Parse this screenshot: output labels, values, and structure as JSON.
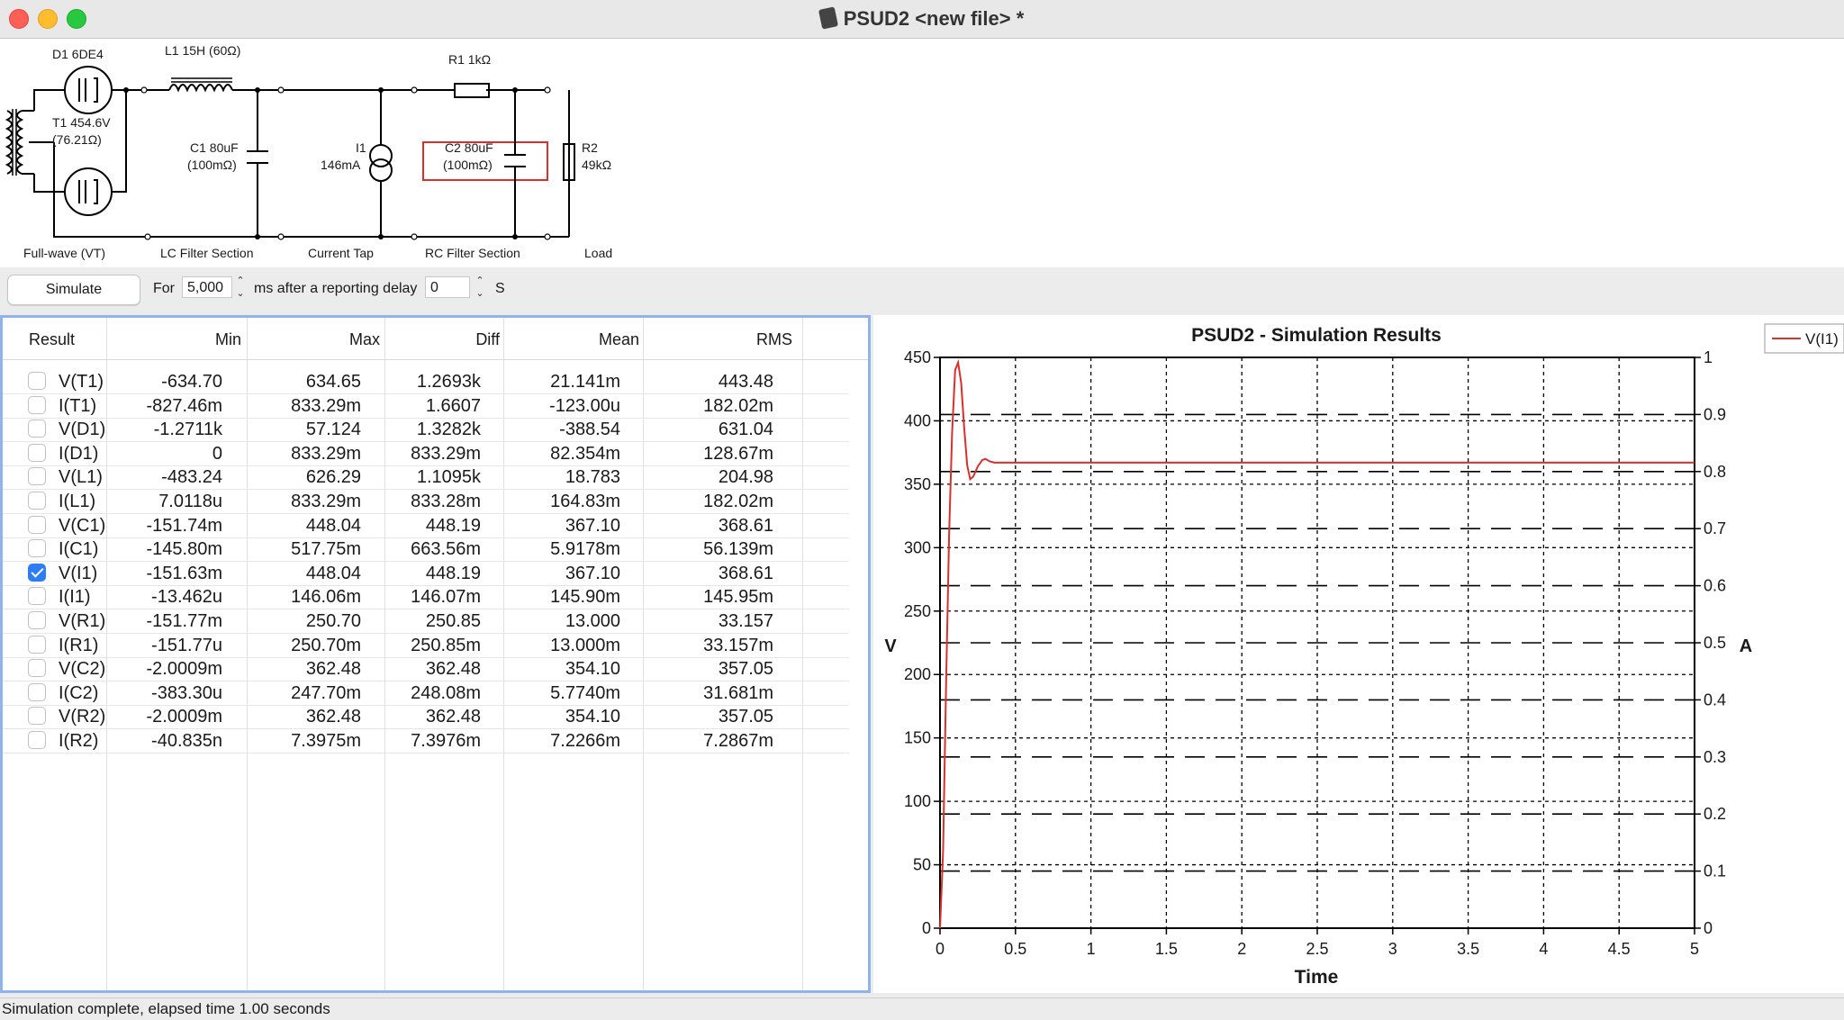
{
  "window": {
    "title": "PSUD2  <new file> *"
  },
  "schematic": {
    "components": {
      "d1": "D1 6DE4",
      "l1": "L1 15H (60Ω)",
      "r1": "R1 1kΩ",
      "t1_line1": "T1 454.6V",
      "t1_line2": "(76.21Ω)",
      "c1_line1": "C1 80uF",
      "c1_line2": "(100mΩ)",
      "i1_line1": "I1",
      "i1_line2": "146mA",
      "c2_line1": "C2 80uF",
      "c2_line2": "(100mΩ)",
      "r2_line1": "R2",
      "r2_line2": "49kΩ"
    },
    "sections": [
      "Full-wave (VT)",
      "LC Filter Section",
      "Current Tap",
      "RC Filter Section",
      "Load"
    ]
  },
  "controls": {
    "simulate_label": "Simulate",
    "for_label": "For",
    "duration_value": "5,000",
    "after_label": "ms after a reporting delay",
    "delay_value": "0",
    "delay_unit": "S"
  },
  "results": {
    "columns": [
      "Result",
      "Min",
      "Max",
      "Diff",
      "Mean",
      "RMS"
    ],
    "rows": [
      {
        "name": "V(T1)",
        "checked": false,
        "min": "-634.70",
        "max": "634.65",
        "diff": "1.2693k",
        "mean": "21.141m",
        "rms": "443.48"
      },
      {
        "name": "I(T1)",
        "checked": false,
        "min": "-827.46m",
        "max": "833.29m",
        "diff": "1.6607",
        "mean": "-123.00u",
        "rms": "182.02m"
      },
      {
        "name": "V(D1)",
        "checked": false,
        "min": "-1.2711k",
        "max": "57.124",
        "diff": "1.3282k",
        "mean": "-388.54",
        "rms": "631.04"
      },
      {
        "name": "I(D1)",
        "checked": false,
        "min": "0",
        "max": "833.29m",
        "diff": "833.29m",
        "mean": "82.354m",
        "rms": "128.67m"
      },
      {
        "name": "V(L1)",
        "checked": false,
        "min": "-483.24",
        "max": "626.29",
        "diff": "1.1095k",
        "mean": "18.783",
        "rms": "204.98"
      },
      {
        "name": "I(L1)",
        "checked": false,
        "min": "7.0118u",
        "max": "833.29m",
        "diff": "833.28m",
        "mean": "164.83m",
        "rms": "182.02m"
      },
      {
        "name": "V(C1)",
        "checked": false,
        "min": "-151.74m",
        "max": "448.04",
        "diff": "448.19",
        "mean": "367.10",
        "rms": "368.61"
      },
      {
        "name": "I(C1)",
        "checked": false,
        "min": "-145.80m",
        "max": "517.75m",
        "diff": "663.56m",
        "mean": "5.9178m",
        "rms": "56.139m"
      },
      {
        "name": "V(I1)",
        "checked": true,
        "min": "-151.63m",
        "max": "448.04",
        "diff": "448.19",
        "mean": "367.10",
        "rms": "368.61"
      },
      {
        "name": "I(I1)",
        "checked": false,
        "min": "-13.462u",
        "max": "146.06m",
        "diff": "146.07m",
        "mean": "145.90m",
        "rms": "145.95m"
      },
      {
        "name": "V(R1)",
        "checked": false,
        "min": "-151.77m",
        "max": "250.70",
        "diff": "250.85",
        "mean": "13.000",
        "rms": "33.157"
      },
      {
        "name": "I(R1)",
        "checked": false,
        "min": "-151.77u",
        "max": "250.70m",
        "diff": "250.85m",
        "mean": "13.000m",
        "rms": "33.157m"
      },
      {
        "name": "V(C2)",
        "checked": false,
        "min": "-2.0009m",
        "max": "362.48",
        "diff": "362.48",
        "mean": "354.10",
        "rms": "357.05"
      },
      {
        "name": "I(C2)",
        "checked": false,
        "min": "-383.30u",
        "max": "247.70m",
        "diff": "248.08m",
        "mean": "5.7740m",
        "rms": "31.681m"
      },
      {
        "name": "V(R2)",
        "checked": false,
        "min": "-2.0009m",
        "max": "362.48",
        "diff": "362.48",
        "mean": "354.10",
        "rms": "357.05"
      },
      {
        "name": "I(R2)",
        "checked": false,
        "min": "-40.835n",
        "max": "7.3975m",
        "diff": "7.3976m",
        "mean": "7.2266m",
        "rms": "7.2867m"
      }
    ]
  },
  "chart_data": {
    "type": "line",
    "title": "PSUD2 - Simulation Results",
    "xlabel": "Time",
    "ylabel": "V",
    "y2label": "A",
    "xlim": [
      0,
      5
    ],
    "ylim": [
      0,
      450
    ],
    "y2lim": [
      0,
      1
    ],
    "xticks": [
      0,
      0.5,
      1,
      1.5,
      2,
      2.5,
      3,
      3.5,
      4,
      4.5,
      5
    ],
    "yticks": [
      0,
      50,
      100,
      150,
      200,
      250,
      300,
      350,
      400,
      450
    ],
    "y2ticks": [
      0,
      0.1,
      0.2,
      0.3,
      0.4,
      0.5,
      0.6,
      0.7,
      0.8,
      0.9,
      1
    ],
    "grid": true,
    "legend": "top-right",
    "series": [
      {
        "name": "V(I1)",
        "color": "#d9302c",
        "x": [
          0,
          0.02,
          0.04,
          0.06,
          0.08,
          0.1,
          0.12,
          0.14,
          0.16,
          0.18,
          0.2,
          0.22,
          0.25,
          0.28,
          0.3,
          0.33,
          0.36,
          0.4,
          0.5,
          0.75,
          1,
          1.5,
          2,
          2.5,
          3,
          3.5,
          4,
          4.5,
          5
        ],
        "y": [
          0,
          60,
          190,
          310,
          390,
          440,
          446,
          430,
          395,
          365,
          354,
          356,
          364,
          369,
          370,
          368,
          367,
          367,
          367,
          367,
          367,
          367,
          367,
          367,
          367,
          367,
          367,
          367,
          367
        ]
      }
    ]
  },
  "status": {
    "text": "Simulation complete, elapsed time 1.00 seconds"
  }
}
